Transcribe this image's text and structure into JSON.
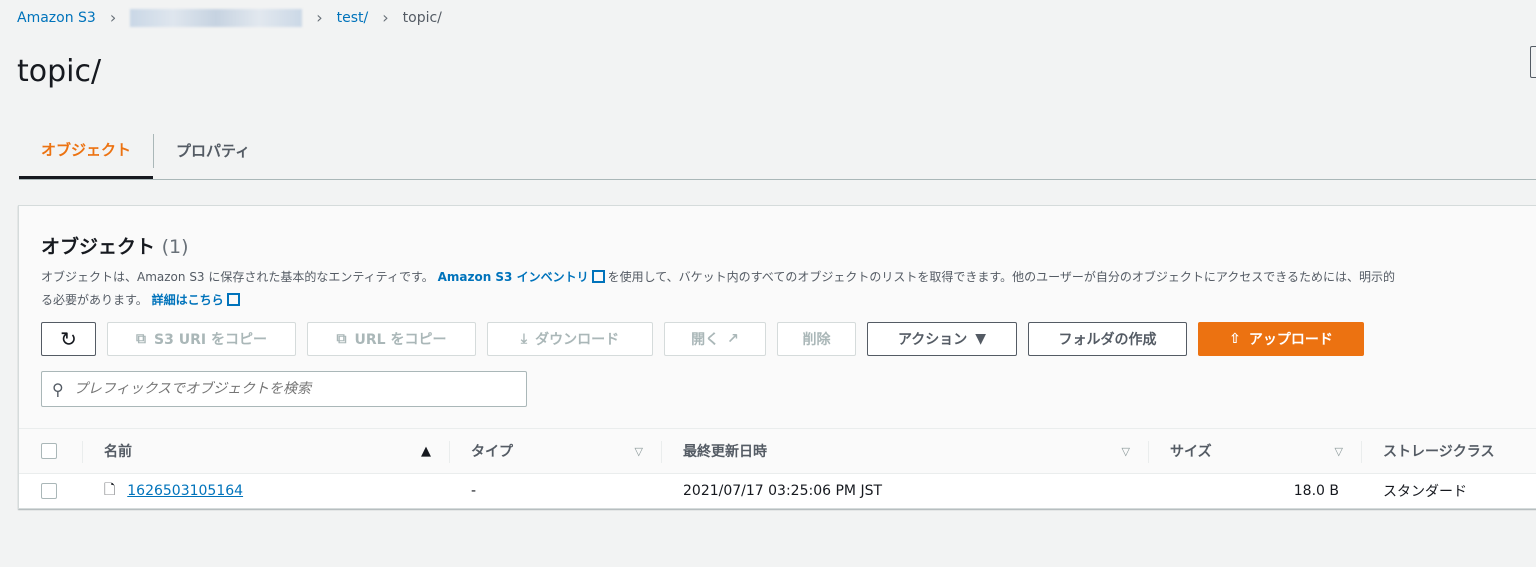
{
  "breadcrumb": {
    "root": "Amazon S3",
    "bucket_blurred": "",
    "folder": "test/",
    "current": "topic/"
  },
  "page_title": "topic/",
  "tabs": [
    {
      "label": "オブジェクト",
      "active": true
    },
    {
      "label": "プロパティ",
      "active": false
    }
  ],
  "panel": {
    "title": "オブジェクト",
    "count": "(1)",
    "desc_1": "オブジェクトは、Amazon S3 に保存された基本的なエンティティです。",
    "desc_link_1": "Amazon S3 インベントリ",
    "desc_2": "を使用して、バケット内のすべてのオブジェクトのリストを取得できます。他のユーザーが自分のオブジェクトにアクセスできるためには、明示的",
    "desc_3": "る必要があります。",
    "desc_link_2": "詳細はこちら"
  },
  "toolbar": {
    "copy_s3_uri": "S3 URI をコピー",
    "copy_url": "URL をコピー",
    "download": "ダウンロード",
    "open": "開く",
    "delete": "削除",
    "actions": "アクション",
    "create_folder": "フォルダの作成",
    "upload": "アップロード"
  },
  "search": {
    "placeholder": "プレフィックスでオブジェクトを検索",
    "value": ""
  },
  "table": {
    "headers": {
      "name": "名前",
      "type": "タイプ",
      "modified": "最終更新日時",
      "size": "サイズ",
      "storage": "ストレージクラス"
    },
    "rows": [
      {
        "name": "1626503105164",
        "type": "-",
        "modified": "2021/07/17 03:25:06 PM JST",
        "size": "18.0 B",
        "storage": "スタンダード"
      }
    ]
  },
  "colors": {
    "accent": "#ec7211",
    "link": "#0073bb"
  }
}
